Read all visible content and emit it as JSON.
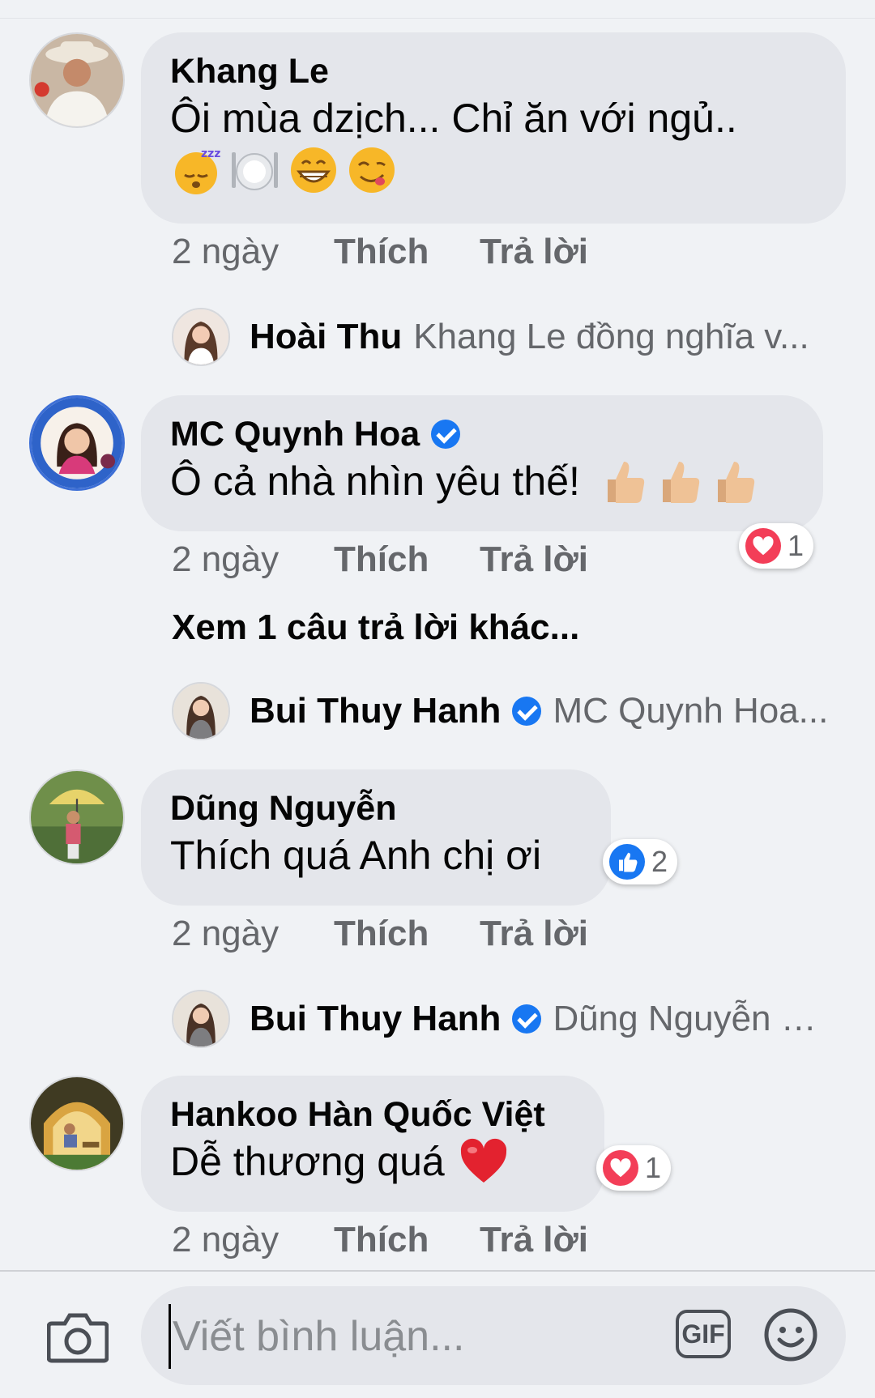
{
  "comments": [
    {
      "author": "Khang Le",
      "text": "Ôi mùa dzịch... Chỉ ăn với ngủ..",
      "emojis": [
        "sleeping-face",
        "plate-with-cutlery",
        "grinning-face",
        "yum-face"
      ],
      "time": "2 ngày",
      "like": "Thích",
      "reply": "Trả lời"
    },
    {
      "author": "MC Quynh Hoa",
      "verified": true,
      "text": "Ô cả nhà nhìn yêu thế!",
      "emojis": [
        "thumbs-up",
        "thumbs-up",
        "thumbs-up"
      ],
      "reaction": {
        "type": "love",
        "count": "1"
      },
      "time": "2 ngày",
      "like": "Thích",
      "reply": "Trả lời"
    },
    {
      "author": "Dũng Nguyễn",
      "text": "Thích quá Anh chị ơi",
      "reaction": {
        "type": "like",
        "count": "2"
      },
      "time": "2 ngày",
      "like": "Thích",
      "reply": "Trả lời"
    },
    {
      "author": "Hankoo Hàn Quốc Việt",
      "text": "Dễ thương quá",
      "emojis": [
        "red-heart"
      ],
      "reaction": {
        "type": "love",
        "count": "1"
      },
      "time": "2 ngày",
      "like": "Thích",
      "reply": "Trả lời"
    }
  ],
  "replies": [
    {
      "author": "Hoài Thu",
      "preview": "Khang Le  đồng nghĩa v..."
    },
    {
      "author": "Bui Thuy Hanh",
      "verified": true,
      "preview": "MC Quynh Hoa..."
    },
    {
      "author": "Bui Thuy Hanh",
      "verified": true,
      "preview": "Dũng Nguyễn Đ..."
    }
  ],
  "more_replies": "Xem 1 câu trả lời khác...",
  "composer": {
    "placeholder": "Viết bình luận...",
    "gif_label": "GIF",
    "camera_icon": "camera-icon",
    "emoji_icon": "smile-icon"
  },
  "colors": {
    "accent": "#1877f2",
    "love": "#f33e58",
    "bubble": "#e4e6eb",
    "background": "#f0f2f5"
  }
}
